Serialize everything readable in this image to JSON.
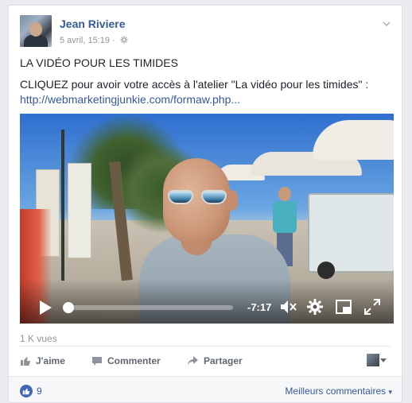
{
  "post": {
    "author": "Jean Riviere",
    "timestamp": "5 avril, 15:19",
    "audience_icon": "gear-icon",
    "menu_icon": "chevron-down-icon",
    "title": "LA VIDÉO POUR LES TIMIDES",
    "body": "CLIQUEZ pour avoir votre accès à l'atelier \"La vidéo pour les timides\" :",
    "link": "http://webmarketingjunkie.com/formaw.php..."
  },
  "video": {
    "time_remaining": "-7:17",
    "progress": 0,
    "icons": [
      "play-icon",
      "mute-icon",
      "settings-icon",
      "picture-in-picture-icon",
      "fullscreen-icon"
    ]
  },
  "stats": {
    "views": "1 K vues",
    "likes": "9"
  },
  "actions": {
    "like": "J'aime",
    "comment": "Commenter",
    "share": "Partager"
  },
  "footer": {
    "sort_label": "Meilleurs commentaires"
  },
  "colors": {
    "link": "#365899",
    "like_blue": "#4267b2",
    "meta_gray": "#90949c",
    "background": "#e9ebee"
  }
}
